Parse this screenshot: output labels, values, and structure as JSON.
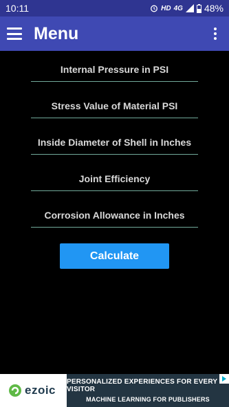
{
  "status_bar": {
    "time": "10:11",
    "network": "HD",
    "signal_type": "4G",
    "battery": "48%",
    "icons": [
      "alarm-icon",
      "signal-icon",
      "battery-icon"
    ]
  },
  "app_bar": {
    "title": "Menu",
    "icons": [
      "menu-icon",
      "more-vert-icon"
    ],
    "color": "#3f49b3"
  },
  "form": {
    "fields": [
      {
        "placeholder": "Internal Pressure in PSI",
        "value": ""
      },
      {
        "placeholder": "Stress Value of Material PSI",
        "value": ""
      },
      {
        "placeholder": "Inside Diameter of Shell in Inches",
        "value": ""
      },
      {
        "placeholder": "Joint Efficiency",
        "value": ""
      },
      {
        "placeholder": "Corrosion Allowance in Inches",
        "value": ""
      }
    ],
    "underline_color": "#72ab9c",
    "calculate_label": "Calculate",
    "button_color": "#2196f3"
  },
  "ad": {
    "brand": "ezoic",
    "line1": "PERSONALIZED EXPERIENCES FOR EVERY VISITOR",
    "line2": "MACHINE LEARNING FOR PUBLISHERS"
  }
}
